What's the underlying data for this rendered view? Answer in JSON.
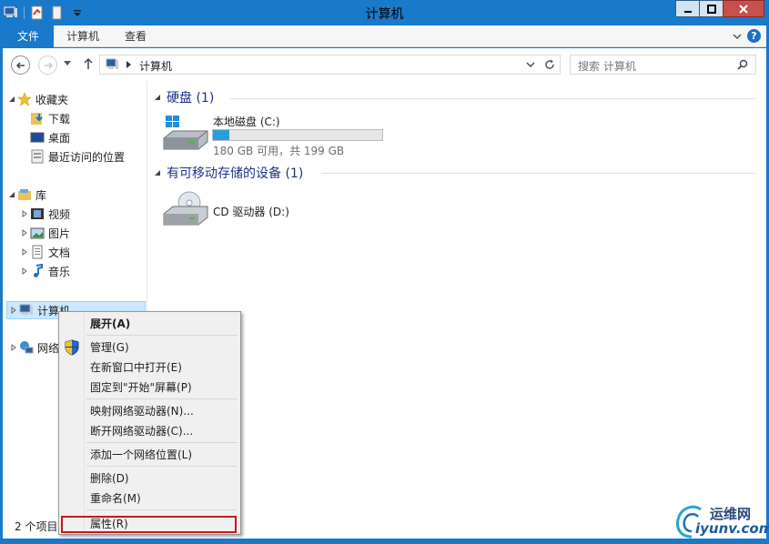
{
  "window": {
    "title": "计算机"
  },
  "ribbon": {
    "tabs": [
      "文件",
      "计算机",
      "查看"
    ],
    "help": "?"
  },
  "address": {
    "path": "计算机",
    "search_placeholder": "搜索 计算机"
  },
  "nav": {
    "favorites": {
      "label": "收藏夹",
      "items": [
        "下载",
        "桌面",
        "最近访问的位置"
      ]
    },
    "libraries": {
      "label": "库",
      "items": [
        "视频",
        "图片",
        "文档",
        "音乐"
      ]
    },
    "computer": "计算机",
    "network": "网络"
  },
  "main": {
    "hard_disks_title": "硬盘 (1)",
    "drive_c": {
      "name": "本地磁盘 (C:)",
      "free": "180 GB 可用，共 199 GB",
      "used_fraction": 0.095
    },
    "removable_title": "有可移动存储的设备 (1)",
    "drive_d": {
      "name": "CD 驱动器 (D:)"
    }
  },
  "status": {
    "items": "2 个项目"
  },
  "menu": {
    "items": [
      "展开(A)",
      "管理(G)",
      "在新窗口中打开(E)",
      "固定到\"开始\"屏幕(P)",
      "映射网络驱动器(N)...",
      "断开网络驱动器(C)...",
      "添加一个网络位置(L)",
      "删除(D)",
      "重命名(M)",
      "属性(R)"
    ]
  },
  "watermark": {
    "line1": "运维网",
    "line2": "iyunv.com"
  },
  "colors": {
    "accent": "#1979ca",
    "selection": "#cce8ff",
    "highlight_box": "#c8161d",
    "drive_fill": "#26a0da"
  }
}
